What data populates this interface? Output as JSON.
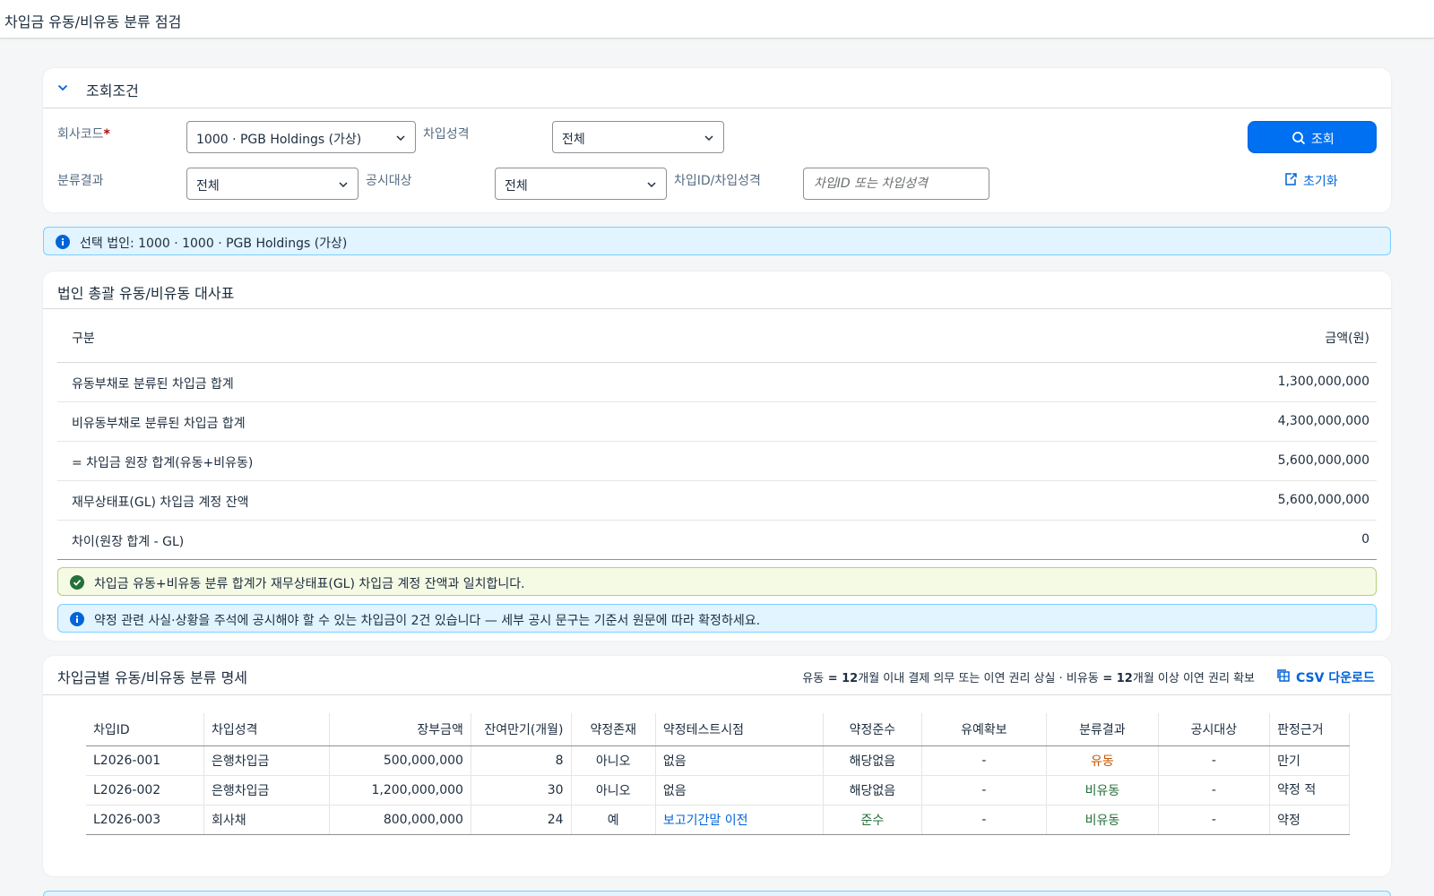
{
  "app": {
    "title": "차입금 유동/비유동 분류 점검"
  },
  "filter": {
    "panel_title": "조회조건",
    "company_label": "회사코드",
    "required_mark": "*",
    "company_value": "1000 · PGB Holdings (가상)",
    "borrow_type_label": "차입성격",
    "borrow_type_value": "전체",
    "class_label": "분류결과",
    "class_value": "전체",
    "disclosure_label": "공시대상",
    "disclosure_value": "전체",
    "search_label": "차입ID/차입성격",
    "search_placeholder": "차입ID 또는 차입성격",
    "search_button": "조회",
    "reset_button": "초기화"
  },
  "info_strip": "선택 법인: 1000 · 1000 · PGB Holdings (가상)",
  "summary": {
    "panel_title": "법인 총괄 유동/비유동 대사표",
    "col_item": "구분",
    "col_amount": "금액(원)",
    "rows": [
      {
        "label": "유동부채로 분류된 차입금 합계",
        "amount": "1,300,000,000"
      },
      {
        "label": "비유동부채로 분류된 차입금 합계",
        "amount": "4,300,000,000"
      },
      {
        "label": "= 차입금 원장 합계(유동+비유동)",
        "amount": "5,600,000,000"
      },
      {
        "label": "재무상태표(GL) 차입금 계정 잔액",
        "amount": "5,600,000,000"
      },
      {
        "label": "차이(원장 합계 - GL)",
        "amount": "0"
      }
    ],
    "success_msg": "차입금 유동+비유동 분류 합계가 재무상태표(GL) 차입금 계정 잔액과 일치합니다.",
    "info_msg": "약정 관련 사실·상황을 주석에 공시해야 할 수 있는 차입금이 2건 있습니다 — 세부 공시 문구는 기준서 원문에 따라 확정하세요."
  },
  "detail": {
    "panel_title": "차입금별 유동/비유동 분류 명세",
    "legend": {
      "p1": "유동",
      "eq1": " = ",
      "n1": "12",
      "p2": "개월 이내 결제 의무 또는 이연 권리 상실 · 비유동",
      "eq2": " = ",
      "n2": "12",
      "p3": "개월 이상 이연 권리 확보"
    },
    "csv_button": "CSV 다운로드",
    "columns": [
      "차입ID",
      "차입성격",
      "장부금액",
      "잔여만기(개월)",
      "약정존재",
      "약정테스트시점",
      "약정준수",
      "유예확보",
      "분류결과",
      "공시대상",
      "판정근거"
    ],
    "rows": [
      [
        "L2026-001",
        "은행차입금",
        "500,000,000",
        "8",
        "아니오",
        "없음",
        "해당없음",
        "-",
        "유동",
        "-",
        "만기"
      ],
      [
        "L2026-002",
        "은행차입금",
        "1,200,000,000",
        "30",
        "아니오",
        "없음",
        "해당없음",
        "-",
        "비유동",
        "-",
        "약정 적"
      ],
      [
        "L2026-003",
        "회사채",
        "800,000,000",
        "24",
        "예",
        "보고기간말 이전",
        "준수",
        "-",
        "비유동",
        "-",
        "약정"
      ]
    ]
  },
  "colors": {
    "accent": "#0070f2",
    "current": "#c35500",
    "noncurrent": "#256f3a",
    "link": "#0064d9"
  }
}
